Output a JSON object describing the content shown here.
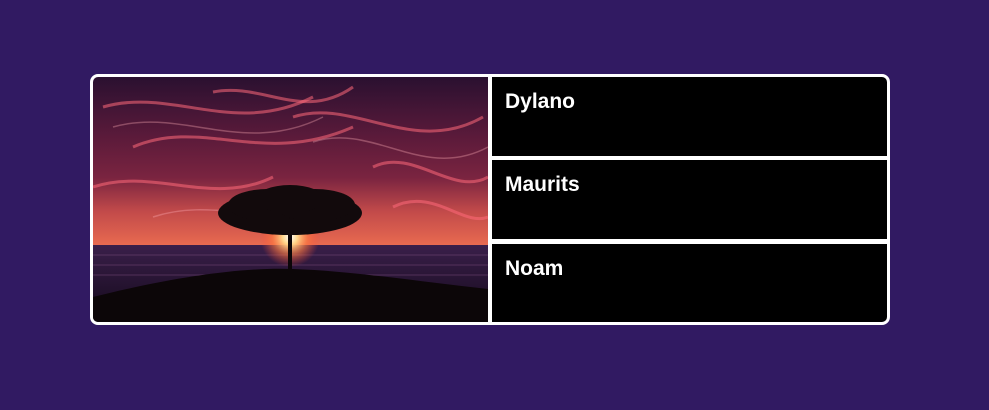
{
  "card": {
    "image": {
      "icon": "tree-at-sunset-photo"
    },
    "names": [
      {
        "label": "Dylano"
      },
      {
        "label": "Maurits"
      },
      {
        "label": "Noam"
      }
    ]
  },
  "colors": {
    "background": "#311a62",
    "card_border": "#ffffff",
    "row_background": "#000000",
    "text": "#ffffff"
  }
}
